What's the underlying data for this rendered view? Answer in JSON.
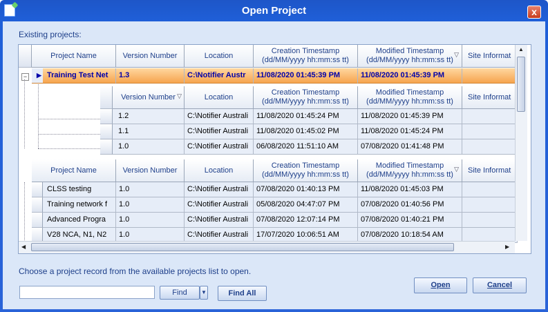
{
  "window": {
    "title": "Open Project",
    "close_glyph": "x"
  },
  "labels": {
    "existing": "Existing projects:",
    "hint": "Choose a project record from the available projects list to open."
  },
  "columns": {
    "project_name": "Project Name",
    "version_number": "Version Number",
    "location": "Location",
    "creation": "Creation Timestamp\n(dd/MM/yyyy hh:mm:ss tt)",
    "modified": "Modified Timestamp\n(dd/MM/yyyy hh:mm:ss tt)",
    "site": "Site Informat"
  },
  "selected_project": {
    "name": "Training Test Net",
    "version": "1.3",
    "location": "C:\\Notifier Austr",
    "created": "11/08/2020 01:45:39 PM",
    "modified": "11/08/2020 01:45:39 PM"
  },
  "sub_columns": {
    "version_number": "Version Number",
    "location": "Location",
    "creation": "Creation Timestamp\n(dd/MM/yyyy hh:mm:ss tt)",
    "modified": "Modified Timestamp\n(dd/MM/yyyy hh:mm:ss tt)",
    "site": "Site Informat"
  },
  "versions": [
    {
      "version": "1.2",
      "location": "C:\\Notifier Australi",
      "created": "11/08/2020 01:45:24 PM",
      "modified": "11/08/2020 01:45:39 PM"
    },
    {
      "version": "1.1",
      "location": "C:\\Notifier Australi",
      "created": "11/08/2020 01:45:02 PM",
      "modified": "11/08/2020 01:45:24 PM"
    },
    {
      "version": "1.0",
      "location": "C:\\Notifier Australi",
      "created": "06/08/2020 11:51:10 AM",
      "modified": "07/08/2020 01:41:48 PM"
    }
  ],
  "projects": [
    {
      "name": "CLSS testing",
      "version": "1.0",
      "location": "C:\\Notifier Australi",
      "created": "07/08/2020 01:40:13 PM",
      "modified": "11/08/2020 01:45:03 PM"
    },
    {
      "name": "Training network f",
      "version": "1.0",
      "location": "C:\\Notifier Australi",
      "created": "05/08/2020 04:47:07 PM",
      "modified": "07/08/2020 01:40:56 PM"
    },
    {
      "name": "Advanced Progra",
      "version": "1.0",
      "location": "C:\\Notifier Australi",
      "created": "07/08/2020 12:07:14 PM",
      "modified": "07/08/2020 01:40:21 PM"
    },
    {
      "name": "V28 NCA, N1, N2",
      "version": "1.0",
      "location": "C:\\Notifier Australi",
      "created": "17/07/2020 10:06:51 AM",
      "modified": "07/08/2020 10:18:54 AM"
    }
  ],
  "buttons": {
    "find": "Find",
    "find_all": "Find All",
    "open": "Open",
    "cancel": "Cancel"
  },
  "search": {
    "value": ""
  },
  "colors": {
    "title_bar": "#1f5fd8",
    "selected_row": "#f6a44e",
    "selected_text": "#0000aa",
    "label_text": "#1e3f8a"
  }
}
